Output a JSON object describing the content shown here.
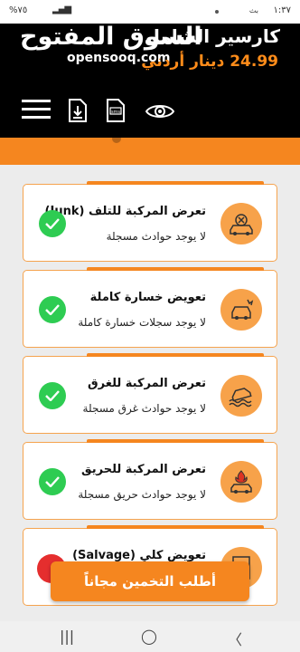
{
  "status": {
    "time": "١:٣٧",
    "net": "بث",
    "battery": "%٧٥"
  },
  "header": {
    "logo_ar": "السوق المفتوح",
    "logo_en": "opensooq.com",
    "title": "كارسير الشامل",
    "price": "24.99 دينار أردني",
    "tools": [
      "menu-icon",
      "download-icon",
      "sms-icon",
      "eye-icon"
    ]
  },
  "checks": [
    {
      "title": "تعرض المركبة للتلف (Junk)",
      "subtitle": "لا يوجد حوادث مسجلة",
      "icon": "junk-car-icon",
      "status": "ok"
    },
    {
      "title": "تعويض خسارة كاملة",
      "subtitle": "لا يوجد سجلات خسارة كاملة",
      "icon": "total-loss-icon",
      "status": "ok"
    },
    {
      "title": "تعرض المركبة للغرق",
      "subtitle": "لا يوجد حوادث غرق مسجلة",
      "icon": "flood-car-icon",
      "status": "ok"
    },
    {
      "title": "تعرض المركبة للحريق",
      "subtitle": "لا يوجد حوادث حريق مسجلة",
      "icon": "fire-car-icon",
      "status": "ok"
    },
    {
      "title": "تعويض كلي (Salvage)",
      "subtitle": "",
      "icon": "salvage-doc-icon",
      "status": "warning"
    }
  ],
  "cta": {
    "label": "أطلب التخمين مجاناً"
  },
  "colors": {
    "accent": "#f5861f",
    "success": "#2ecc52",
    "danger": "#e52e2e"
  }
}
